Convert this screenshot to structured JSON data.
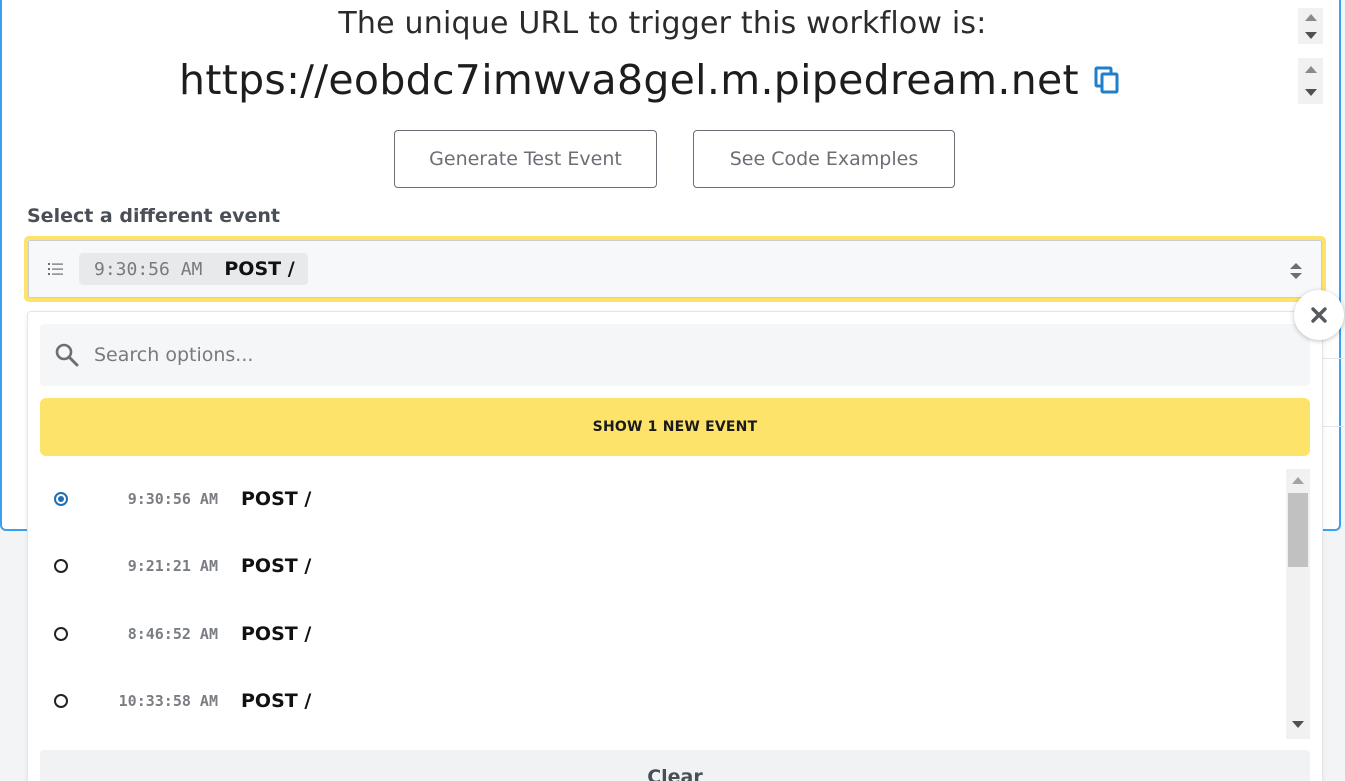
{
  "trigger": {
    "headline": "The unique URL to trigger this workflow is:",
    "url": "https://eobdc7imwva8gel.m.pipedream.net"
  },
  "actions": {
    "generate_label": "Generate Test Event",
    "examples_label": "See Code Examples"
  },
  "event_select": {
    "label": "Select a different event",
    "selected": {
      "time": "9:30:56 AM",
      "route": "POST /"
    },
    "accent_color": "#fde36a"
  },
  "dropdown": {
    "search_placeholder": "Search options...",
    "new_event_button": "SHOW 1 NEW EVENT",
    "events": [
      {
        "time": "9:30:56 AM",
        "route": "POST /",
        "selected": true
      },
      {
        "time": "9:21:21 AM",
        "route": "POST /",
        "selected": false
      },
      {
        "time": "8:46:52 AM",
        "route": "POST /",
        "selected": false
      },
      {
        "time": "10:33:58 AM",
        "route": "POST /",
        "selected": false
      }
    ],
    "clear_label": "Clear"
  },
  "icons": {
    "copy": "copy-icon",
    "list": "list-icon",
    "sort": "sort-arrows-icon",
    "close": "close-icon",
    "search": "search-icon"
  },
  "colors": {
    "card_border": "#3aa0ef",
    "copy_icon": "#1f7fc9",
    "radio_selected": "#1f6fb4"
  }
}
